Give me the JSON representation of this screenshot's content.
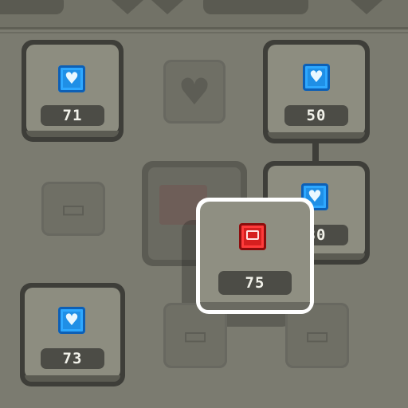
{
  "grid": {
    "tiles": [
      {
        "name": "heart-tile-top-left",
        "value": "71",
        "icon": "heart-icon"
      },
      {
        "name": "heart-tile-top-right",
        "value": "50",
        "icon": "heart-icon"
      },
      {
        "name": "heart-tile-middle-right",
        "value": "80",
        "icon": "heart-icon"
      },
      {
        "name": "heart-tile-bottom-left",
        "value": "73",
        "icon": "heart-icon"
      }
    ],
    "selected": {
      "value": "75",
      "icon": "red-module-icon"
    },
    "locked_icons": [
      "heart-outline-icon",
      "module-outline-icon",
      "module-outline-icon",
      "module-outline-icon"
    ]
  },
  "colors": {
    "gem_blue": "#1f8fe6",
    "gem_red": "#d61f1f",
    "panel": "#7b7b70",
    "selection": "#ffffff"
  }
}
